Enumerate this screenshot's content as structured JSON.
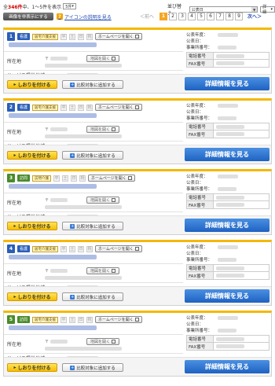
{
  "header": {
    "total_prefix": "全",
    "total_count": "346件",
    "total_suffix": "中、1〜5件を表示",
    "per_page_value": "5件",
    "sort_label": "並び替え:",
    "sort_value": "公表日",
    "view_value": "詳細"
  },
  "toolbar": {
    "hide_images_label": "画像を非表示にする",
    "icon_help_label": "アイコンの説明を見る"
  },
  "pager": {
    "prev_label": "＜前へ",
    "pages": [
      "1",
      "2",
      "3",
      "4",
      "5",
      "6",
      "7",
      "8",
      "9"
    ],
    "current_page": "1",
    "next_label": "次へ＞"
  },
  "labels": {
    "address": "所在地",
    "service_area": "サービス提供地域",
    "published_year": "公表年度：",
    "published_date": "公表日：",
    "office_number": "事業所番号：",
    "phone": "電話番号",
    "fax": "FAX番号",
    "homepage": "ホームページを開く",
    "map": "地図を開く",
    "bookmark": "しおりを付ける",
    "compare": "比較対象に追加する",
    "details": "詳細情報を見る",
    "days": [
      "平",
      "土",
      "日",
      "祝"
    ]
  },
  "cards": [
    {
      "num": "1",
      "type": "看護",
      "service_tag": "居宅介護支援",
      "type_color": "#2a5fb8"
    },
    {
      "num": "2",
      "type": "看護",
      "service_tag": "居宅介護支援",
      "type_color": "#2a5fb8"
    },
    {
      "num": "3",
      "type": "訪問",
      "service_tag": "訪問介護",
      "type_color": "#4a8b2a"
    },
    {
      "num": "4",
      "type": "看護",
      "service_tag": "居宅介護支援",
      "type_color": "#2a5fb8"
    },
    {
      "num": "5",
      "type": "訪問",
      "service_tag": "居宅介護支援",
      "type_color": "#4a8b2a"
    }
  ]
}
